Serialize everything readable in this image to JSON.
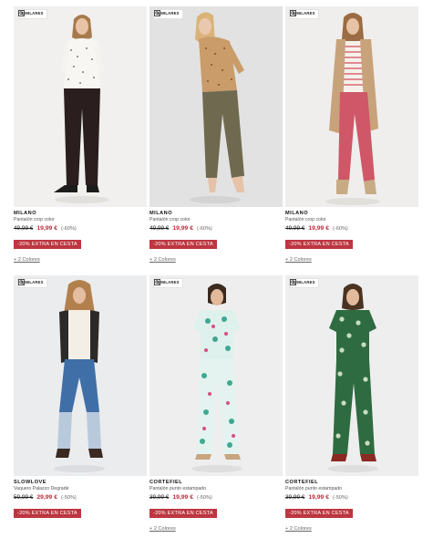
{
  "similar_label": "SIMILARES",
  "products": [
    {
      "brand": "MILANO",
      "name": "Pantalón crop color",
      "old_price": "49,99 €",
      "new_price": "19,99 €",
      "discount": "(-60%)",
      "promo": "-20% EXTRA EN CESTA",
      "colors": "+ 2 Colores"
    },
    {
      "brand": "MILANO",
      "name": "Pantalón crop color",
      "old_price": "49,99 €",
      "new_price": "19,99 €",
      "discount": "(-60%)",
      "promo": "-20% EXTRA EN CESTA",
      "colors": "+ 2 Colores"
    },
    {
      "brand": "MILANO",
      "name": "Pantalón crop color",
      "old_price": "49,99 €",
      "new_price": "19,99 €",
      "discount": "(-60%)",
      "promo": "-20% EXTRA EN CESTA",
      "colors": "+ 2 Colores"
    },
    {
      "brand": "SLOWLOVE",
      "name": "Vaquero Palazzo Degradé",
      "old_price": "59,99 €",
      "new_price": "29,99 €",
      "discount": "(-50%)",
      "promo": "-20% EXTRA EN CESTA",
      "colors": ""
    },
    {
      "brand": "CORTEFIEL",
      "name": "Pantalón punto estampado",
      "old_price": "39,99 €",
      "new_price": "19,99 €",
      "discount": "(-50%)",
      "promo": "-20% EXTRA EN CESTA",
      "colors": "+ 2 Colores"
    },
    {
      "brand": "CORTEFIEL",
      "name": "Pantalón punto estampado",
      "old_price": "39,99 €",
      "new_price": "19,99 €",
      "discount": "(-50%)",
      "promo": "-20% EXTRA EN CESTA",
      "colors": "+ 2 Colores"
    }
  ]
}
